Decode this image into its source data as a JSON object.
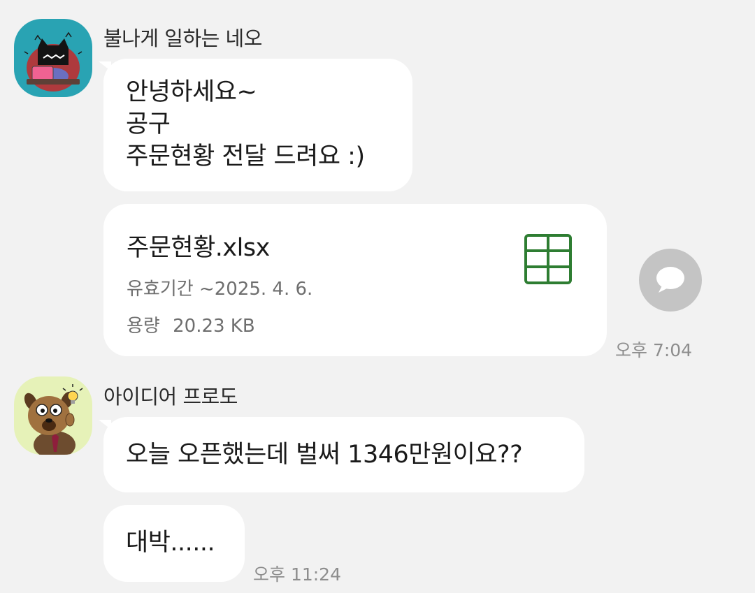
{
  "messages": [
    {
      "sender": "불나게 일하는 네오",
      "text": "안녕하세요~\n공구\n주문현황 전달 드려요 :)",
      "file": {
        "name": "주문현황.xlsx",
        "expiry_label": "유효기간",
        "expiry_value": "~2025. 4. 6.",
        "size_label": "용량",
        "size_value": "20.23 KB",
        "icon": "spreadsheet-icon"
      },
      "time": "오후 7:04"
    },
    {
      "sender": "아이디어 프로도",
      "text": "오늘 오픈했는데 벌써 1346만원이요??",
      "text2": "대박......",
      "time": "오후 11:24"
    }
  ],
  "colors": {
    "background": "#f2f2f2",
    "bubble": "#ffffff",
    "excel_green": "#2e7d32",
    "share_button": "#c4c4c4"
  }
}
